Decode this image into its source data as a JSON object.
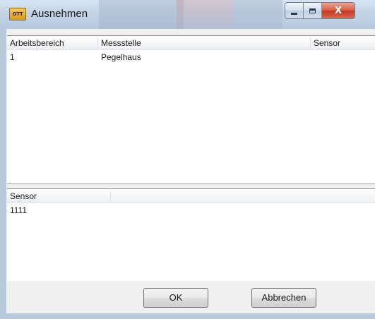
{
  "window": {
    "title": "Ausnehmen",
    "app_icon_text": "OTT",
    "close_glyph": "X"
  },
  "top_list": {
    "columns": [
      "Arbeitsbereich",
      "Messstelle",
      "Sensor"
    ],
    "rows": [
      [
        "1",
        "Pegelhaus",
        ""
      ]
    ]
  },
  "bottom_list": {
    "columns": [
      "Sensor"
    ],
    "rows": [
      [
        "1111"
      ]
    ]
  },
  "buttons": {
    "ok_label": "OK",
    "cancel_label": "Abbrechen"
  },
  "colors": {
    "frame": "#b9c9dc",
    "client_bg": "#f0f0f0",
    "close_red": "#c2391f"
  }
}
